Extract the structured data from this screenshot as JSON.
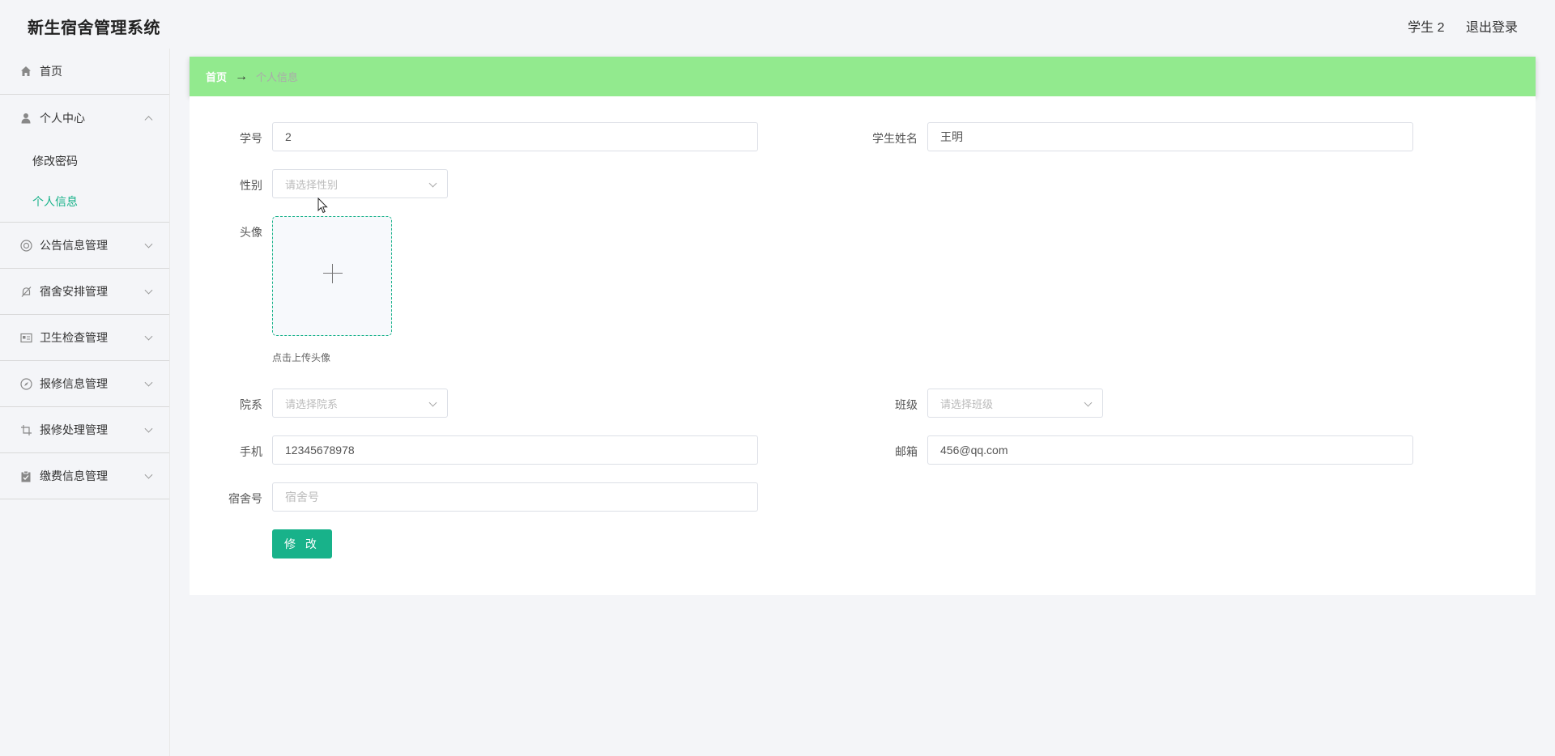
{
  "app": {
    "title": "新生宿舍管理系统"
  },
  "header": {
    "user_label": "学生 2",
    "logout_label": "退出登录"
  },
  "sidebar": {
    "items": [
      {
        "label": "首页",
        "icon": "home-icon"
      },
      {
        "label": "个人中心",
        "icon": "user-icon",
        "expanded": true,
        "children": [
          {
            "label": "修改密码"
          },
          {
            "label": "个人信息",
            "active": true
          }
        ]
      },
      {
        "label": "公告信息管理",
        "icon": "lifebuoy-icon"
      },
      {
        "label": "宿舍安排管理",
        "icon": "bell-off-icon"
      },
      {
        "label": "卫生检查管理",
        "icon": "id-card-icon"
      },
      {
        "label": "报修信息管理",
        "icon": "compass-icon"
      },
      {
        "label": "报修处理管理",
        "icon": "crop-icon"
      },
      {
        "label": "缴费信息管理",
        "icon": "clipboard-icon"
      }
    ]
  },
  "breadcrumb": {
    "home": "首页",
    "separator": "→",
    "current": "个人信息"
  },
  "form": {
    "student_no": {
      "label": "学号",
      "value": "2"
    },
    "student_name": {
      "label": "学生姓名",
      "value": "王明"
    },
    "gender": {
      "label": "性别",
      "placeholder": "请选择性别"
    },
    "avatar": {
      "label": "头像",
      "hint": "点击上传头像"
    },
    "department": {
      "label": "院系",
      "placeholder": "请选择院系"
    },
    "class": {
      "label": "班级",
      "placeholder": "请选择班级"
    },
    "phone": {
      "label": "手机",
      "value": "12345678978"
    },
    "email": {
      "label": "邮箱",
      "value": "456@qq.com"
    },
    "dorm_no": {
      "label": "宿舍号",
      "placeholder": "宿舍号"
    },
    "submit_label": "修 改"
  },
  "colors": {
    "accent": "#18b28a",
    "breadcrumb_bg": "#92ea8e",
    "page_bg": "#f4f5f8"
  }
}
